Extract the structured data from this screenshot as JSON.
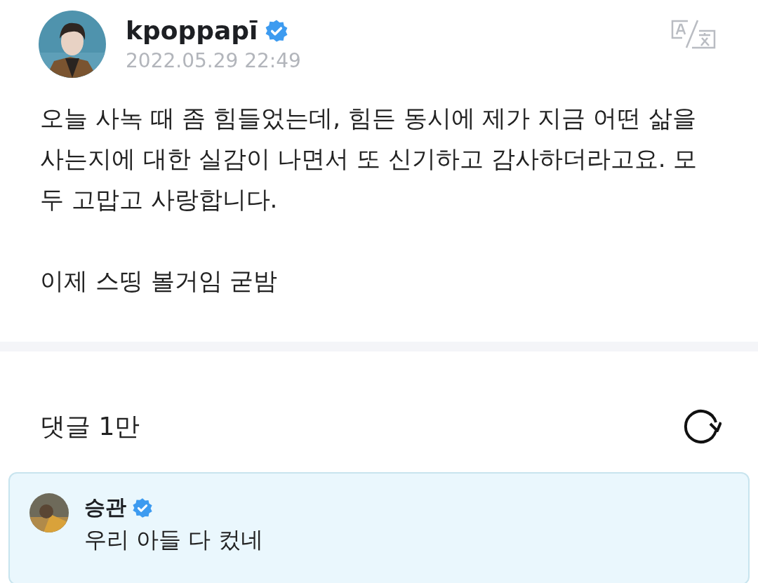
{
  "post": {
    "author": "kpoppapī",
    "verified": true,
    "date": "2022.05.29 22:49",
    "paragraphs": [
      "오늘 사녹 때 좀 힘들었는데, 힘든 동시에 제가 지금 어떤 삶을 사는지에 대한 실감이 나면서 또 신기하고 감사하더라고요. 모두 고맙고 사랑합니다.",
      "이제 스띵 볼거임 굳밤"
    ]
  },
  "comments": {
    "label": "댓글 1만",
    "items": [
      {
        "author": "승관",
        "verified": true,
        "text": "우리 아들 다 컸네"
      }
    ]
  }
}
